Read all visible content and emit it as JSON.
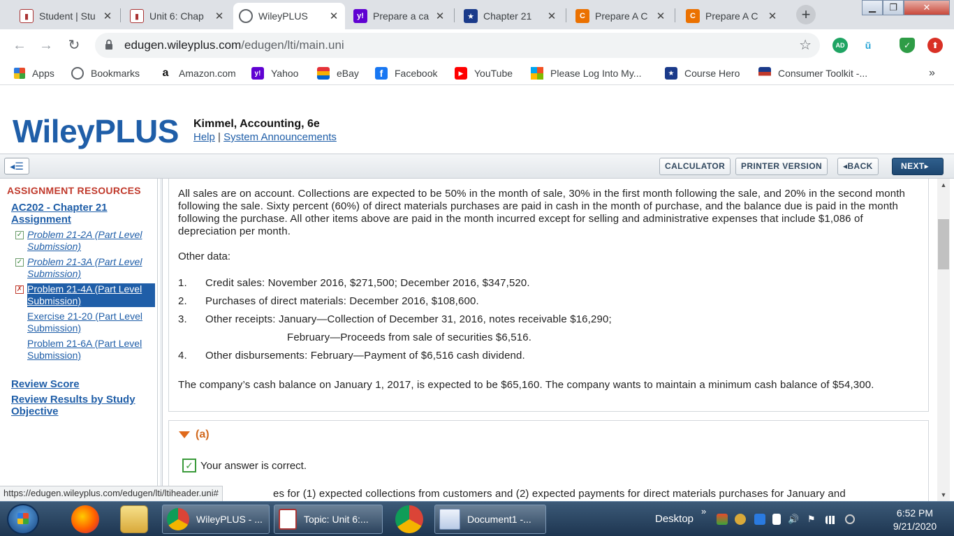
{
  "browser": {
    "tabs": [
      {
        "title": "Student | Stu",
        "icon": "student-icon"
      },
      {
        "title": "Unit 6: Chap",
        "icon": "unit-icon"
      },
      {
        "title": "WileyPLUS",
        "icon": "globe-icon",
        "active": true
      },
      {
        "title": "Prepare a ca",
        "icon": "yahoo-icon"
      },
      {
        "title": "Chapter 21",
        "icon": "coursehero-icon"
      },
      {
        "title": "Prepare A C",
        "icon": "chegg-icon"
      },
      {
        "title": "Prepare A C",
        "icon": "chegg-icon"
      }
    ],
    "url_host": "edugen.wileyplus.com",
    "url_path": "/edugen/lti/main.uni",
    "ext_ad": "AD",
    "bookmarks": [
      {
        "label": "Apps",
        "icon": "apps-icon"
      },
      {
        "label": "Bookmarks",
        "icon": "globe-icon"
      },
      {
        "label": "Amazon.com",
        "icon": "amazon-icon"
      },
      {
        "label": "Yahoo",
        "icon": "yahoo-icon"
      },
      {
        "label": "eBay",
        "icon": "ebay-icon"
      },
      {
        "label": "Facebook",
        "icon": "facebook-icon"
      },
      {
        "label": "YouTube",
        "icon": "youtube-icon"
      },
      {
        "label": "Please Log Into My...",
        "icon": "windows-icon"
      },
      {
        "label": "Course Hero",
        "icon": "coursehero-icon"
      },
      {
        "label": "Consumer Toolkit -...",
        "icon": "flag-icon"
      }
    ],
    "more_bookmarks": "»"
  },
  "wiley": {
    "logo": "WileyPLUS",
    "course": "Kimmel, Accounting, 6e",
    "help": "Help",
    "separator": "|",
    "announcements": "System Announcements",
    "buttons": {
      "calculator": "CALCULATOR",
      "printer": "PRINTER VERSION",
      "back": "BACK",
      "next": "NEXT"
    }
  },
  "sidebar": {
    "heading": "ASSIGNMENT RESOURCES",
    "assignment": "AC202 - Chapter 21 Assignment",
    "items": [
      {
        "label": "Problem 21-2A (Part Level Submission)",
        "status": "correct"
      },
      {
        "label": "Problem 21-3A (Part Level Submission)",
        "status": "correct"
      },
      {
        "label": "Problem 21-4A (Part Level Submission)",
        "status": "incorrect",
        "selected": true
      },
      {
        "label": "Exercise 21-20 (Part Level Submission)",
        "status": "none"
      },
      {
        "label": "Problem 21-6A (Part Level Submission)",
        "status": "none"
      }
    ],
    "review_score": "Review Score",
    "review_results": "Review Results by Study Objective"
  },
  "content": {
    "para1": "All sales are on account. Collections are expected to be 50% in the month of sale, 30% in the first month following the sale, and 20% in the second month following the sale. Sixty percent (60%) of direct materials purchases are paid in cash in the month of purchase, and the balance due is paid in the month following the purchase. All other items above are paid in the month incurred except for selling and administrative expenses that include $1,086 of depreciation per month.",
    "other_label": "Other data:",
    "other_items": [
      {
        "num": "1.",
        "text": "Credit sales: November 2016, $271,500; December 2016, $347,520."
      },
      {
        "num": "2.",
        "text": "Purchases of direct materials: December 2016, $108,600."
      },
      {
        "num": "3.",
        "text": "Other receipts: January—Collection of December 31, 2016, notes receivable $16,290;"
      },
      {
        "num": "",
        "text": "February—Proceeds from sale of securities $6,516."
      },
      {
        "num": "4.",
        "text": "Other disbursements: February—Payment of $6,516 cash dividend."
      }
    ],
    "para2": "The company’s cash balance on January 1, 2017, is expected to be $65,160. The company wants to maintain a minimum cash balance of $54,300.",
    "part_label": "(a)",
    "correct_msg": "Your answer is correct.",
    "trailing": "es for (1) expected collections from customers and (2) expected payments for direct materials purchases for January and"
  },
  "status_url": "https://edugen.wileyplus.com/edugen/lti/ltiheader.uni#",
  "taskbar": {
    "windows": [
      {
        "label": "WileyPLUS - ...",
        "icon": "chrome-icon"
      },
      {
        "label": "Topic: Unit 6:...",
        "icon": "unit-icon"
      },
      {
        "label": "Document1 -...",
        "icon": "word-icon"
      }
    ],
    "desktop": "Desktop",
    "chevron": "»",
    "time": "6:52 PM",
    "date": "9/21/2020"
  },
  "colors": {
    "wiley_blue": "#1f5ea8",
    "resource_red": "#c0392b",
    "part_orange": "#e06a1c",
    "correct_green": "#3a9a3a"
  }
}
